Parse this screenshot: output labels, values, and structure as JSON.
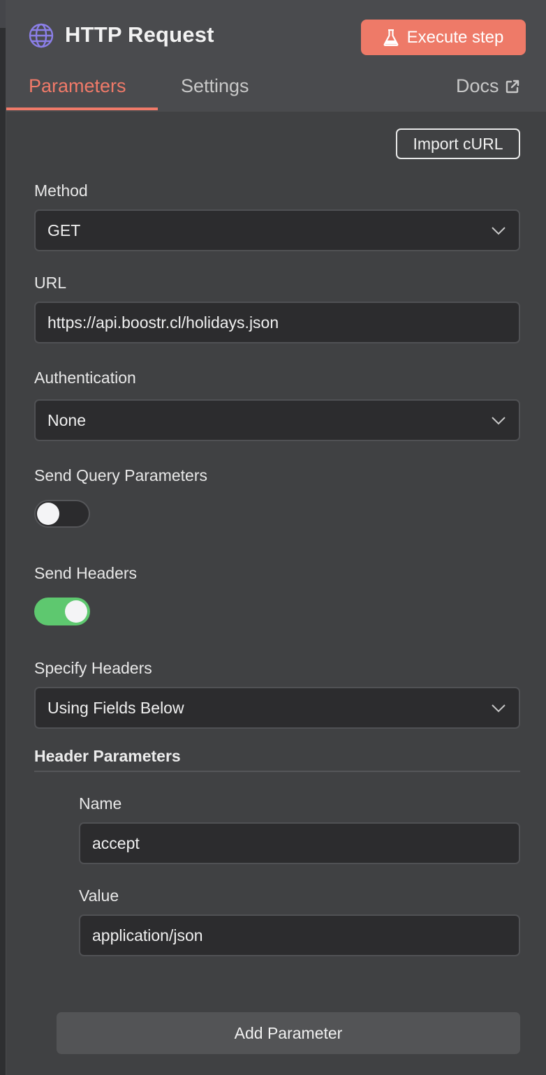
{
  "header": {
    "title": "HTTP Request",
    "execute_label": "Execute step",
    "tabs": [
      {
        "label": "Parameters",
        "active": true
      },
      {
        "label": "Settings",
        "active": false
      }
    ],
    "docs_label": "Docs"
  },
  "colors": {
    "accent": "#f07a69",
    "execute_button": "#ee7a68",
    "toggle_on": "#5ec86f",
    "globe_icon": "#8b7fe8"
  },
  "form": {
    "import_curl_label": "Import cURL",
    "method": {
      "label": "Method",
      "value": "GET"
    },
    "url": {
      "label": "URL",
      "value": "https://api.boostr.cl/holidays.json"
    },
    "authentication": {
      "label": "Authentication",
      "value": "None"
    },
    "send_query": {
      "label": "Send Query Parameters",
      "enabled": false
    },
    "send_headers": {
      "label": "Send Headers",
      "enabled": true
    },
    "specify_headers": {
      "label": "Specify Headers",
      "value": "Using Fields Below"
    },
    "header_parameters": {
      "title": "Header Parameters",
      "name_label": "Name",
      "name_value": "accept",
      "value_label": "Value",
      "value_value": "application/json"
    },
    "add_parameter_label": "Add Parameter"
  },
  "icons": {
    "title": "globe-icon",
    "execute": "flask-icon",
    "docs": "external-link-icon",
    "select": "chevron-down-icon"
  }
}
